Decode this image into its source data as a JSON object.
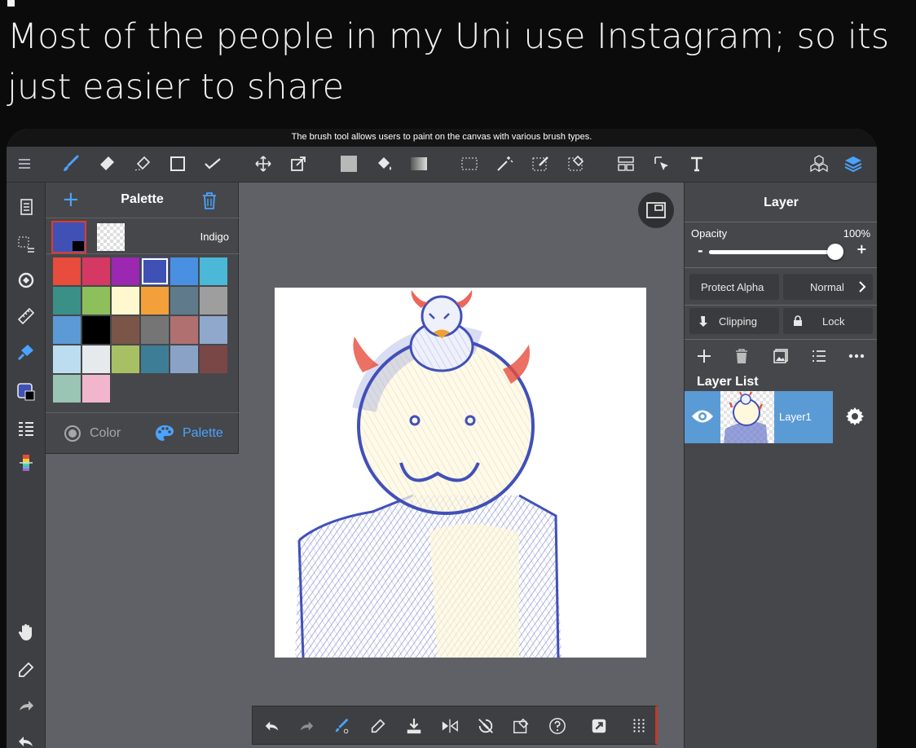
{
  "caption": {
    "line1": "Most of the people in my Uni use Instagram; so its",
    "line2": "just easier to share"
  },
  "app": {
    "hint": "The brush tool allows users to paint on the canvas with various brush types.",
    "accent_color": "#4aa3ff",
    "toolbar_icons": [
      "menu-icon",
      "brush-icon",
      "eraser-icon",
      "smudge-icon",
      "rectangle-icon",
      "correction-icon",
      "move-icon",
      "transform-icon",
      "fill-color-icon",
      "bucket-icon",
      "gradient-icon",
      "select-icon",
      "magic-wand-icon",
      "select-pen-icon",
      "select-eraser-icon",
      "layout-icon",
      "operation-icon",
      "text-icon",
      "3d-icon",
      "layers-icon"
    ],
    "sidebar_icons": [
      "page-icon",
      "selection-icon",
      "rotate-icon",
      "ruler-icon",
      "fill-icon",
      "color-swatch-icon",
      "layer-list-icon",
      "gradient-bar-icon",
      "hand-icon",
      "eyedropper-icon",
      "redo-icon",
      "undo-icon"
    ]
  },
  "palette": {
    "title": "Palette",
    "current_color_name": "Indigo",
    "current_color": "#3f51b5",
    "swatches": [
      "#e74c3c",
      "#d63864",
      "#9c27b0",
      "#3f51b5",
      "#4a90e2",
      "#4ab8d6",
      "#3a8f86",
      "#8dc05a",
      "#fff8cf",
      "#f4a03a",
      "#5f7a8a",
      "#9e9e9e",
      "#5b9ad5",
      "#000000",
      "#7a5548",
      "#757575",
      "#b07070",
      "#8fa8cc",
      "#bcdcf0",
      "#e6eaed",
      "#a8c064",
      "#3e7d96",
      "#8aa2c6",
      "#7a4747",
      "#9ac4b4",
      "#f1b6cc"
    ],
    "selected_index": 3,
    "tab_color": "Color",
    "tab_palette": "Palette"
  },
  "layer_panel": {
    "title": "Layer",
    "opacity_label": "Opacity",
    "opacity_value": "100%",
    "opacity_fraction": 1.0,
    "minus": "-",
    "plus": "+",
    "protect_alpha": "Protect Alpha",
    "blend_mode": "Normal",
    "clipping": "Clipping",
    "lock": "Lock",
    "list_title": "Layer List",
    "layers": [
      {
        "name": "Layer1"
      }
    ]
  },
  "bottom_bar_icons": [
    "undo-icon",
    "redo-icon",
    "brush-size-icon",
    "eyedropper-icon",
    "save-icon",
    "flip-icon",
    "rotate-reset-icon",
    "edit-icon",
    "help-icon",
    "expand-icon",
    "grid-icon"
  ]
}
